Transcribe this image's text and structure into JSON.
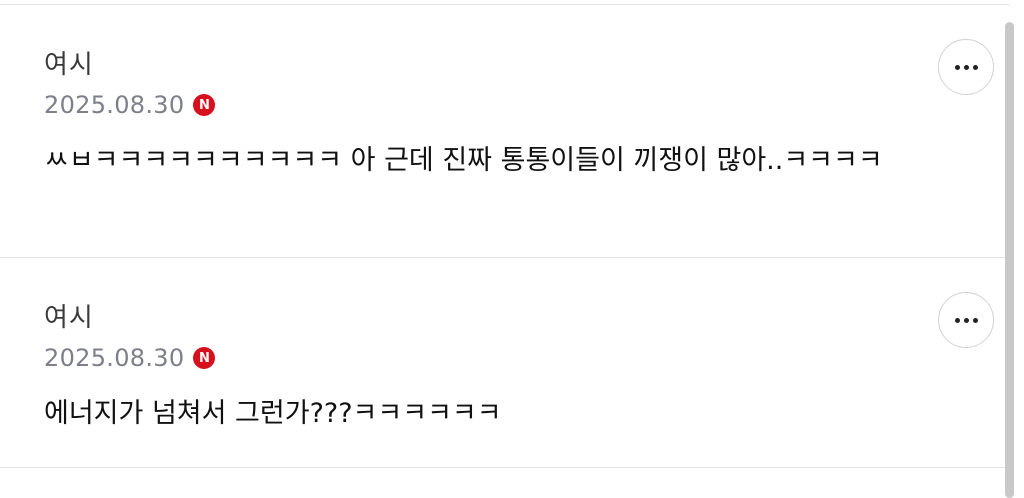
{
  "comments": [
    {
      "author": "여시",
      "date": "2025.08.30",
      "badge": "N",
      "text": "ㅆㅂㅋㅋㅋㅋㅋㅋㅋㅋㅋㅋ 아 근데 진짜 통통이들이 끼쟁이 많아..ㅋㅋㅋㅋ",
      "more_icon": "more-horizontal-icon"
    },
    {
      "author": "여시",
      "date": "2025.08.30",
      "badge": "N",
      "text": "에너지가 넘쳐서 그런가???ㅋㅋㅋㅋㅋㅋ",
      "more_icon": "more-horizontal-icon"
    }
  ],
  "colors": {
    "badge": "#d6101c",
    "date": "#7d7f8a",
    "divider": "#e3e3e3",
    "scrollbar": "#c8c8c8"
  }
}
